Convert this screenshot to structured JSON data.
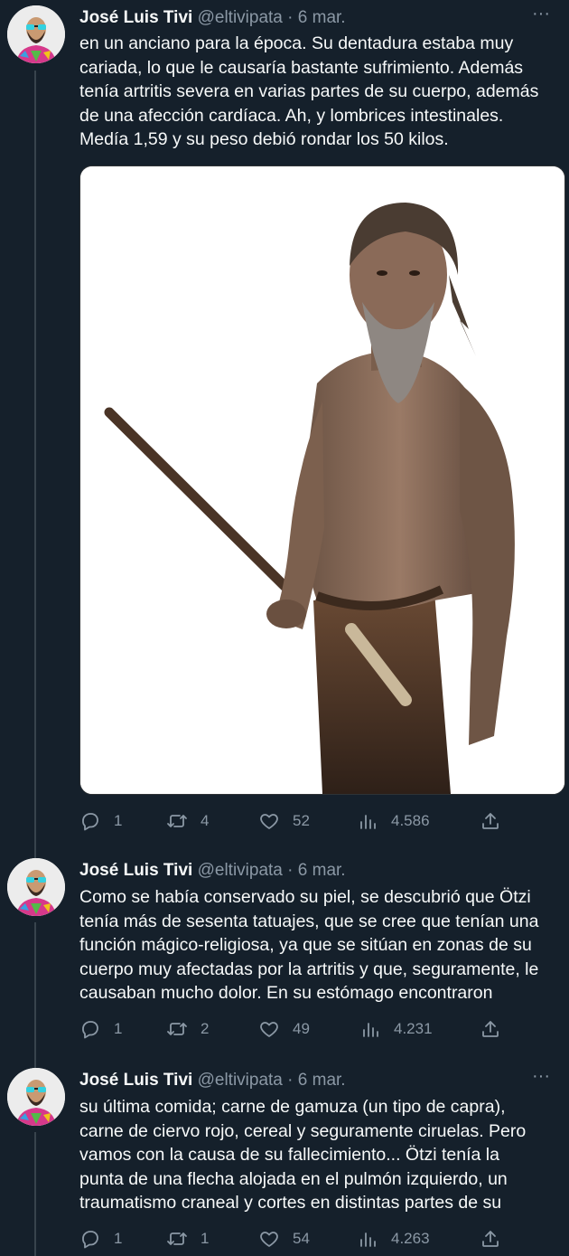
{
  "tweets": [
    {
      "author": {
        "name": "José Luis Tivi",
        "handle": "@eltivipata"
      },
      "separator": "·",
      "date": "6 mar.",
      "more": "···",
      "text": [
        "en un anciano para la época. Su dentadura estaba muy",
        "cariada, lo que le causaría bastante sufrimiento. Además",
        "tenía artritis severa en varias partes de su cuerpo, además",
        "de una afección cardíaca. Ah, y lombrices intestinales.",
        "Medía 1,59 y su peso debió rondar los 50 kilos."
      ],
      "stats": {
        "replies": "1",
        "retweets": "4",
        "likes": "52",
        "views": "4.586"
      }
    },
    {
      "author": {
        "name": "José Luis Tivi",
        "handle": "@eltivipata"
      },
      "separator": "·",
      "date": "6 mar.",
      "more": "···",
      "text": [
        "Como se había conservado su piel, se descubrió que Ötzi",
        "tenía más de sesenta tatuajes, que se cree que tenían una",
        "función mágico-religiosa, ya que se sitúan en zonas de su",
        "cuerpo muy afectadas por la artritis y que, seguramente, le",
        "causaban mucho dolor. En su estómago encontraron"
      ],
      "stats": {
        "replies": "1",
        "retweets": "2",
        "likes": "49",
        "views": "4.231"
      }
    },
    {
      "author": {
        "name": "José Luis Tivi",
        "handle": "@eltivipata"
      },
      "separator": "·",
      "date": "6 mar.",
      "more": "···",
      "text": [
        "su última comida; carne de gamuza (un tipo de capra),",
        "carne de ciervo rojo, cereal y seguramente ciruelas. Pero",
        "vamos con la causa de su fallecimiento... Ötzi tenía la",
        "punta de una flecha alojada en el pulmón izquierdo, un",
        "traumatismo craneal y cortes en distintas partes de su"
      ],
      "stats": {
        "replies": "1",
        "retweets": "1",
        "likes": "54",
        "views": "4.263"
      }
    }
  ],
  "icons": {
    "reply": "reply-icon",
    "retweet": "retweet-icon",
    "like": "heart-icon",
    "views": "views-icon",
    "share": "share-icon"
  },
  "colors": {
    "background": "#15202b",
    "muted": "#8b98a5",
    "text": "#f7f9f9",
    "thread_line": "#38444d"
  }
}
